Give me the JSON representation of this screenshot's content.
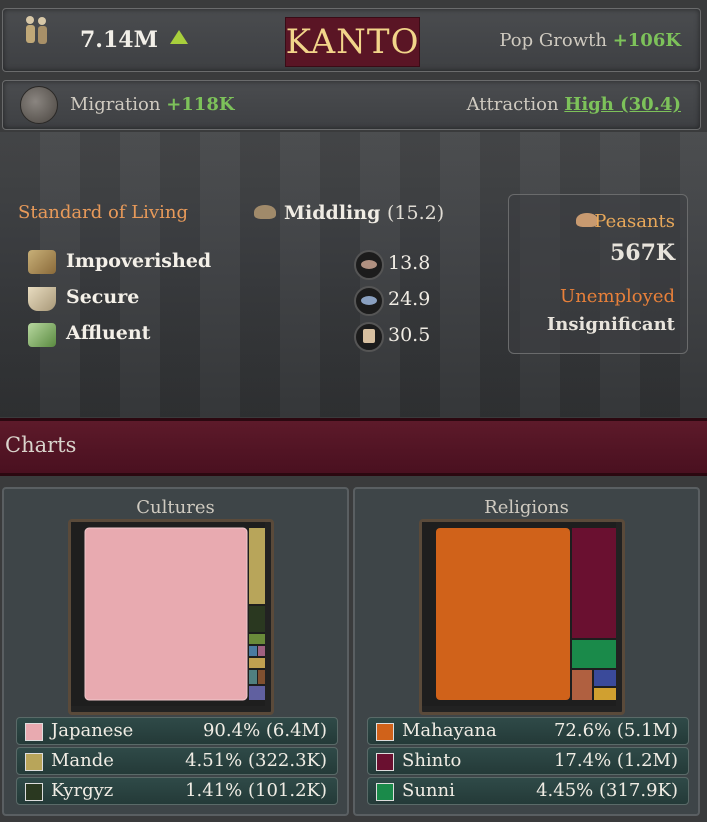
{
  "header": {
    "population": "7.14M",
    "state_name": "KANTO",
    "pop_growth_label": "Pop Growth",
    "pop_growth_value": "+106K"
  },
  "migration": {
    "label": "Migration",
    "value": "+118K",
    "attraction_label": "Attraction",
    "attraction_value": "High (30.4)"
  },
  "living": {
    "label": "Standard of Living",
    "level": "Middling",
    "level_value": "(15.2)",
    "strata": [
      {
        "name": "Impoverished",
        "value": "13.8",
        "color": "#8b6a4a"
      },
      {
        "name": "Secure",
        "value": "24.9",
        "color": "#5a7aa0"
      },
      {
        "name": "Affluent",
        "value": "30.5",
        "color": "#c8a06a"
      }
    ]
  },
  "peasants": {
    "label": "Peasants",
    "value": "567K",
    "unemployed_label": "Unemployed",
    "unemployed_value": "Insignificant"
  },
  "charts": {
    "header": "Charts",
    "cultures": {
      "title": "Cultures",
      "legend": [
        {
          "name": "Japanese",
          "value": "90.4% (6.4M)",
          "color": "#e8aab0"
        },
        {
          "name": "Mande",
          "value": "4.51% (322.3K)",
          "color": "#b8a55a"
        },
        {
          "name": "Kyrgyz",
          "value": "1.41% (101.2K)",
          "color": "#2a3820"
        }
      ]
    },
    "religions": {
      "title": "Religions",
      "legend": [
        {
          "name": "Mahayana",
          "value": "72.6% (5.1M)",
          "color": "#d0621a"
        },
        {
          "name": "Shinto",
          "value": "17.4% (1.2M)",
          "color": "#6a1030"
        },
        {
          "name": "Sunni",
          "value": "4.45% (317.9K)",
          "color": "#1a8a4a"
        }
      ]
    }
  }
}
